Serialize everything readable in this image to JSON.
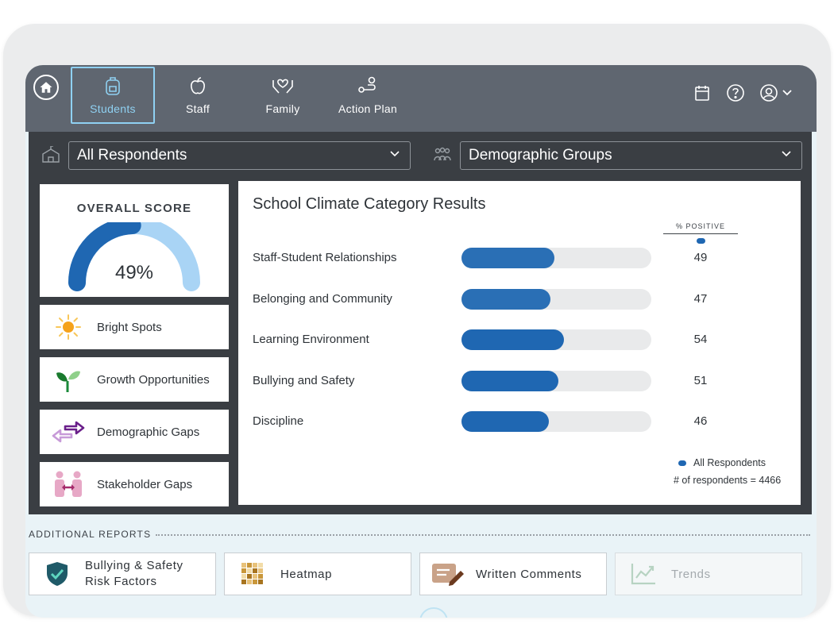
{
  "nav": {
    "items": [
      {
        "label": "Students",
        "icon": "backpack-icon"
      },
      {
        "label": "Staff",
        "icon": "apple-icon"
      },
      {
        "label": "Family",
        "icon": "hands-heart-icon"
      },
      {
        "label": "Action Plan",
        "icon": "route-icon"
      }
    ],
    "right_icons": [
      "calendar-icon",
      "help-icon",
      "user-icon",
      "chevron-down-icon"
    ]
  },
  "filters": {
    "respondents": "All Respondents",
    "groups": "Demographic Groups"
  },
  "overall": {
    "title": "OVERALL SCORE",
    "value_text": "49%",
    "value": 49
  },
  "side_menu": [
    {
      "label": "Bright Spots",
      "icon": "sun-icon"
    },
    {
      "label": "Growth Opportunities",
      "icon": "sprout-icon"
    },
    {
      "label": "Demographic Gaps",
      "icon": "arrows-icon"
    },
    {
      "label": "Stakeholder Gaps",
      "icon": "people-icon"
    }
  ],
  "results": {
    "title": "School Climate Category Results",
    "column_header": "% POSITIVE",
    "legend": "All Respondents",
    "respondents": "# of respondents = 4466"
  },
  "chart_data": {
    "type": "bar",
    "categories": [
      "Staff-Student Relationships",
      "Belonging and Community",
      "Learning Environment",
      "Bullying and Safety",
      "Discipline"
    ],
    "series": [
      {
        "name": "All Respondents",
        "values": [
          49,
          47,
          54,
          51,
          46
        ]
      }
    ],
    "ylim": [
      0,
      100
    ]
  },
  "additional": {
    "title": "ADDITIONAL REPORTS",
    "reports": [
      {
        "line1": "Bullying & Safety",
        "line2": "Risk Factors",
        "icon": "shield-check-icon"
      },
      {
        "label": "Heatmap",
        "icon": "heatmap-icon"
      },
      {
        "label": "Written Comments",
        "icon": "comment-pen-icon"
      },
      {
        "label": "Trends",
        "icon": "trend-chart-icon"
      }
    ]
  },
  "colors": {
    "accent": "#1f67b2",
    "accent_light": "#8fd1f2",
    "topbar": "#5f6670",
    "panel_dark": "#3a3e43"
  }
}
